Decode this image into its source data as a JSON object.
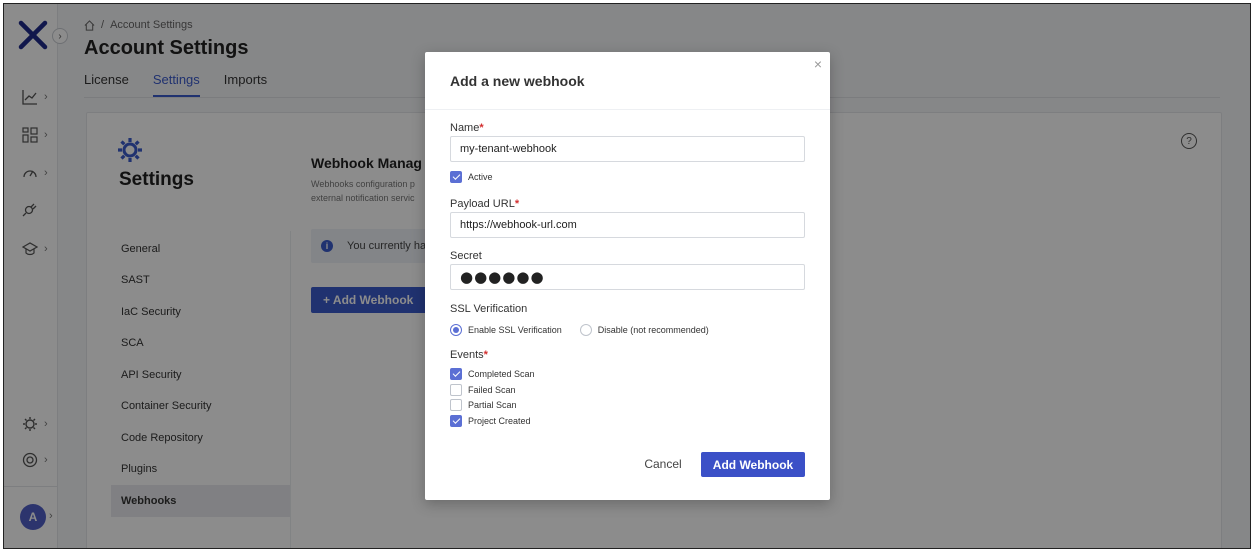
{
  "header": {
    "breadcrumb": "Account Settings",
    "breadcrumb_sep": "/",
    "title": "Account Settings",
    "tabs": [
      {
        "label": "License"
      },
      {
        "label": "Settings"
      },
      {
        "label": "Imports"
      }
    ]
  },
  "rail": {
    "avatar_letter": "A",
    "expand_glyph": "›",
    "chevron": "›"
  },
  "settings": {
    "title": "Settings",
    "nav": [
      {
        "label": "General"
      },
      {
        "label": "SAST"
      },
      {
        "label": "IaC Security"
      },
      {
        "label": "SCA"
      },
      {
        "label": "API Security"
      },
      {
        "label": "Container Security"
      },
      {
        "label": "Code Repository"
      },
      {
        "label": "Plugins"
      },
      {
        "label": "Webhooks"
      }
    ],
    "webhook_title": "Webhook Manag",
    "webhook_desc_1": "Webhooks configuration p",
    "webhook_desc_2": "external notification servic",
    "info_text": "You currently ha",
    "add_button": "+ Add Webhook",
    "help_glyph": "?"
  },
  "modal": {
    "title": "Add a new webhook",
    "close_glyph": "×",
    "name_label": "Name",
    "name_value": "my-tenant-webhook",
    "active_label": "Active",
    "payload_label": "Payload URL",
    "payload_value": "https://webhook-url.com",
    "secret_label": "Secret",
    "secret_value": "●●●●●●",
    "ssl_label": "SSL Verification",
    "ssl_enable": "Enable SSL Verification",
    "ssl_disable": "Disable (not recommended)",
    "events_label": "Events",
    "required_mark": "*",
    "events": [
      {
        "label": "Completed Scan"
      },
      {
        "label": "Failed Scan"
      },
      {
        "label": "Partial Scan"
      },
      {
        "label": "Project Created"
      }
    ],
    "cancel": "Cancel",
    "submit": "Add Webhook"
  },
  "colors": {
    "accent": "#3b5bcc",
    "checkbox": "#5b6fd4",
    "required": "#d32f2f"
  }
}
